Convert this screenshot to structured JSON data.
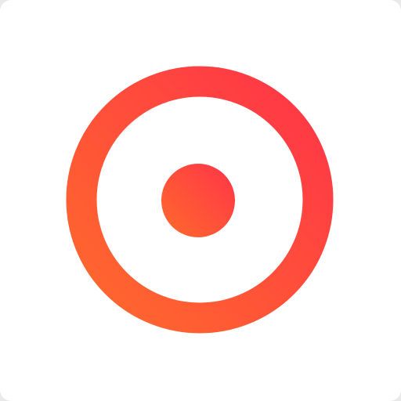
{
  "app_icon": {
    "icon": "record-icon",
    "background_color": "#ffffff",
    "gradient": {
      "start_color": "#ff6a2c",
      "end_color": "#ff3448"
    }
  }
}
